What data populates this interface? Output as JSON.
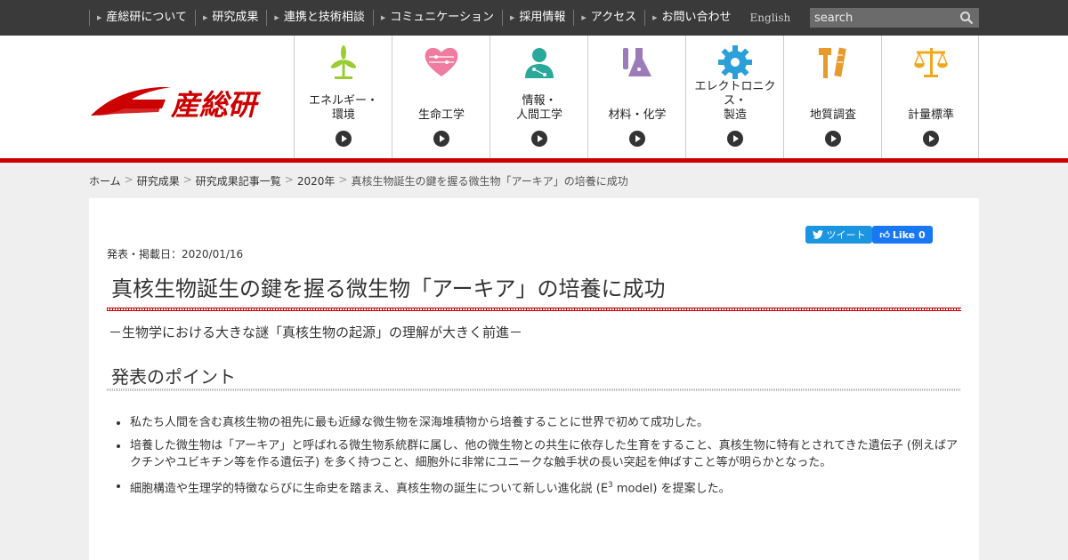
{
  "topnav": {
    "items": [
      "産総研について",
      "研究成果",
      "連携と技術相談",
      "コミュニケーション",
      "採用情報",
      "アクセス",
      "お問い合わせ"
    ],
    "english": "English",
    "search_placeholder": "search"
  },
  "header": {
    "logo_text": "産総研",
    "categories": [
      {
        "label": "エネルギー・\n環境",
        "icon": "windmill-icon"
      },
      {
        "label": "生命工学",
        "icon": "heart-icon"
      },
      {
        "label": "情報・\n人間工学",
        "icon": "person-icon"
      },
      {
        "label": "材料・化学",
        "icon": "flask-icon"
      },
      {
        "label": "エレクトロニクス・\n製造",
        "icon": "gear-icon"
      },
      {
        "label": "地質調査",
        "icon": "hammer-icon"
      },
      {
        "label": "計量標準",
        "icon": "scale-icon"
      }
    ]
  },
  "breadcrumb": [
    "ホーム",
    "研究成果",
    "研究成果記事一覧",
    "2020年",
    "真核生物誕生の鍵を握る微生物「アーキア」の培養に成功"
  ],
  "article": {
    "tweet_label": "ツイート",
    "like_label": "Like 0",
    "date": "発表・掲載日：2020/01/16",
    "title": "真核生物誕生の鍵を握る微生物「アーキア」の培養に成功",
    "subtitle": "－生物学における大きな謎「真核生物の起源」の理解が大きく前進－",
    "points_heading": "発表のポイント",
    "points": [
      "私たち人間を含む真核生物の祖先に最も近縁な微生物を深海堆積物から培養することに世界で初めて成功した。",
      "培養した微生物は「アーキア」と呼ばれる微生物系統群に属し、他の微生物との共生に依存した生育をすること、真核生物に特有とされてきた遺伝子 (例えばアクチンやユビキチン等を作る遺伝子) を多く持つこと、細胞外に非常にユニークな触手状の長い突起を伸ばすこと等が明らかとなった。",
      "細胞構造や生理学的特徴ならびに生命史を踏まえ、真核生物の誕生について新しい進化説 (E",
      "3",
      " model) を提案した。"
    ]
  },
  "colors": {
    "brand_red": "#cc0000",
    "topbar": "#3a3a3a",
    "icon_green": "#9acd32",
    "icon_pink": "#f07ca0",
    "icon_teal": "#2aa89a",
    "icon_purple": "#9b7bb8",
    "icon_blue": "#2a9fd8",
    "icon_orange": "#e89a2a",
    "icon_gold": "#f0a820"
  }
}
